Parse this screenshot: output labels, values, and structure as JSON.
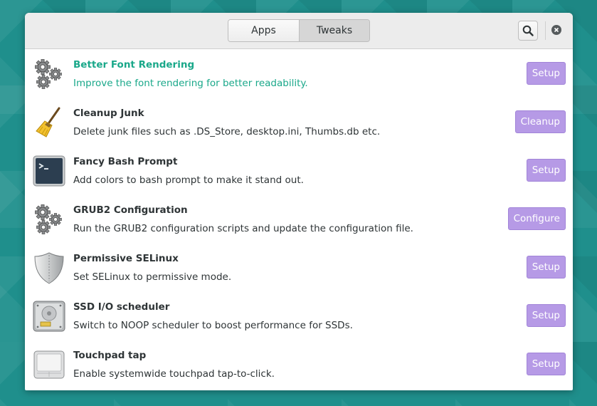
{
  "header": {
    "tabs": [
      {
        "label": "Apps",
        "active": false
      },
      {
        "label": "Tweaks",
        "active": true
      }
    ],
    "search_icon": "search-icon",
    "close_icon": "close-icon"
  },
  "colors": {
    "accent": "#1aa88a",
    "button": "#b69ae6"
  },
  "tweaks": [
    {
      "title": "Better Font Rendering",
      "desc": "Improve the font rendering for better readability.",
      "action": "Setup",
      "icon": "gears-icon"
    },
    {
      "title": "Cleanup Junk",
      "desc": "Delete junk files such as .DS_Store, desktop.ini, Thumbs.db etc.",
      "action": "Cleanup",
      "icon": "broom-icon"
    },
    {
      "title": "Fancy Bash Prompt",
      "desc": "Add colors to bash prompt to make it stand out.",
      "action": "Setup",
      "icon": "terminal-icon"
    },
    {
      "title": "GRUB2 Configuration",
      "desc": "Run the GRUB2 configuration scripts and update the configuration file.",
      "action": "Configure",
      "icon": "gears-icon"
    },
    {
      "title": "Permissive SELinux",
      "desc": "Set SELinux to permissive mode.",
      "action": "Setup",
      "icon": "shield-icon"
    },
    {
      "title": "SSD I/O scheduler",
      "desc": "Switch to NOOP scheduler to boost performance for SSDs.",
      "action": "Setup",
      "icon": "drive-icon"
    },
    {
      "title": "Touchpad tap",
      "desc": "Enable systemwide touchpad tap-to-click.",
      "action": "Setup",
      "icon": "touchpad-icon"
    }
  ]
}
